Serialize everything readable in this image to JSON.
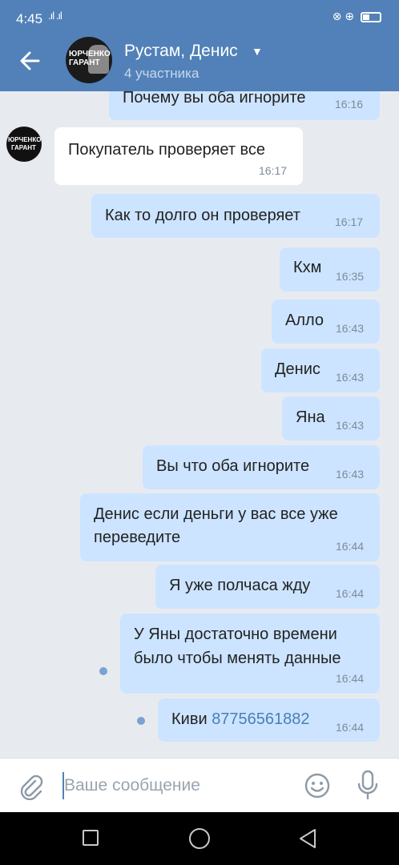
{
  "status_bar": {
    "time": "4:45",
    "signal": ".ıl .ıl",
    "icons": "⊗ ⊕"
  },
  "header": {
    "title": "Рустам, Денис",
    "subtitle": "4 участника",
    "avatar_text": "ЮРЧЕНКО ГАРАНТ"
  },
  "incoming_avatar": {
    "line1": "ЮРЧЕНКО",
    "line2": "ГАРАНТ"
  },
  "messages": [
    {
      "dir": "out",
      "text": "Почему вы оба игнорите",
      "time": "16:16"
    },
    {
      "dir": "in",
      "text": "Покупатель проверяет все",
      "time": "16:17"
    },
    {
      "dir": "out",
      "text": "Как то долго он проверяет",
      "time": "16:17"
    },
    {
      "dir": "out",
      "text": "Кхм",
      "time": "16:35"
    },
    {
      "dir": "out",
      "text": "Алло",
      "time": "16:43"
    },
    {
      "dir": "out",
      "text": "Денис",
      "time": "16:43"
    },
    {
      "dir": "out",
      "text": "Яна",
      "time": "16:43"
    },
    {
      "dir": "out",
      "text": "Вы что оба игнорите",
      "time": "16:43"
    },
    {
      "dir": "out",
      "line1": "Денис если деньги у вас все уже",
      "line2": "переведите",
      "time": "16:44"
    },
    {
      "dir": "out",
      "text": "Я уже полчаса жду",
      "time": "16:44"
    },
    {
      "dir": "out",
      "line1": "У Яны достаточно времени",
      "line2": "было чтобы менять данные",
      "time": "16:44"
    },
    {
      "dir": "out",
      "text": "Киви",
      "link": "87756561882",
      "time": "16:44"
    }
  ],
  "composer": {
    "placeholder": "Ваше сообщение"
  },
  "icons": {
    "back": "arrow-left-icon",
    "attach": "paperclip-icon",
    "emoji": "smile-icon",
    "mic": "microphone-icon",
    "nav_recent": "square-icon",
    "nav_home": "circle-icon",
    "nav_back": "triangle-icon"
  },
  "colors": {
    "header": "#5181b8",
    "outgoing": "#cce4ff",
    "incoming": "#ffffff",
    "background": "#e7ebf0",
    "link": "#4a7fb6"
  }
}
